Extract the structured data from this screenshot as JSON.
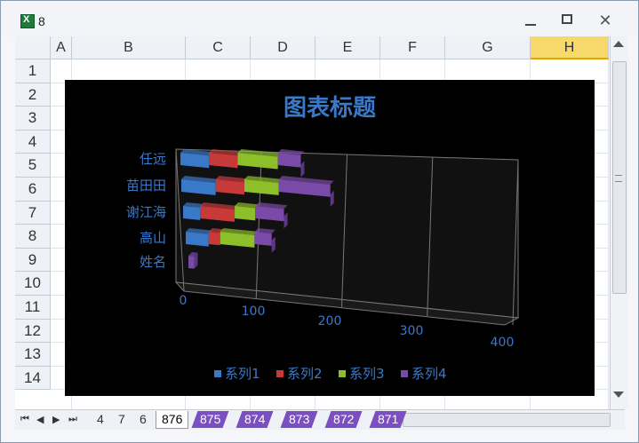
{
  "window": {
    "title": "8"
  },
  "columns": [
    "A",
    "B",
    "C",
    "D",
    "E",
    "F",
    "G",
    "H"
  ],
  "selected_column": "H",
  "rows": [
    "1",
    "2",
    "3",
    "4",
    "5",
    "6",
    "7",
    "8",
    "9",
    "10",
    "11",
    "12",
    "13",
    "14"
  ],
  "sheet_tabs": {
    "plain": [
      "4",
      "7",
      "6"
    ],
    "active": "876",
    "purple": [
      "875",
      "874",
      "873",
      "872",
      "871"
    ]
  },
  "chart_data": {
    "type": "bar",
    "orientation": "horizontal-stacked-3d",
    "title": "图表标题",
    "categories": [
      "任远",
      "苗田田",
      "谢江海",
      "高山",
      "姓名"
    ],
    "series": [
      {
        "name": "系列1",
        "color": "#3a78c8",
        "values": [
          25,
          30,
          15,
          20,
          0
        ]
      },
      {
        "name": "系列2",
        "color": "#c83a3a",
        "values": [
          25,
          25,
          30,
          10,
          0
        ]
      },
      {
        "name": "系列3",
        "color": "#8cbf2a",
        "values": [
          35,
          30,
          18,
          30,
          0
        ]
      },
      {
        "name": "系列4",
        "color": "#7a4aa8",
        "values": [
          20,
          45,
          25,
          15,
          5
        ]
      }
    ],
    "xaxis_ticks": [
      "0",
      "100",
      "200",
      "300",
      "400"
    ],
    "xlim": [
      0,
      400
    ],
    "grid": true,
    "legend": "bottom",
    "colors": {
      "background": "#000000",
      "text": "#3a78c8"
    }
  }
}
